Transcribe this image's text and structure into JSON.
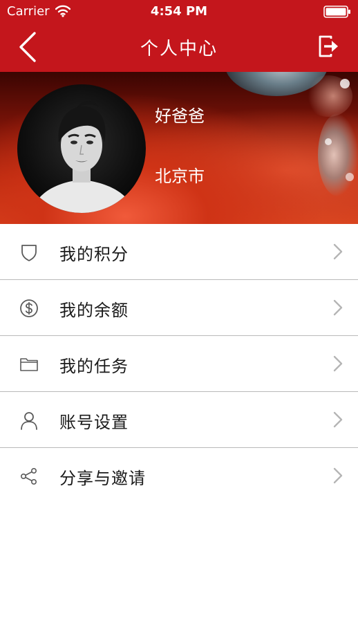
{
  "status_bar": {
    "carrier": "Carrier",
    "time": "4:54 PM"
  },
  "nav": {
    "title": "个人中心"
  },
  "profile": {
    "name": "好爸爸",
    "city": "北京市"
  },
  "menu": {
    "items": [
      {
        "label": "我的积分",
        "icon": "shield-icon"
      },
      {
        "label": "我的余额",
        "icon": "dollar-coin-icon"
      },
      {
        "label": "我的任务",
        "icon": "folder-icon"
      },
      {
        "label": "账号设置",
        "icon": "user-icon"
      },
      {
        "label": "分享与邀请",
        "icon": "share-icon"
      }
    ]
  },
  "colors": {
    "primary_red": "#c4161c",
    "icon_gray": "#5a5a5a",
    "chevron_gray": "#b5b5b5",
    "divider": "#b9b9b9"
  }
}
